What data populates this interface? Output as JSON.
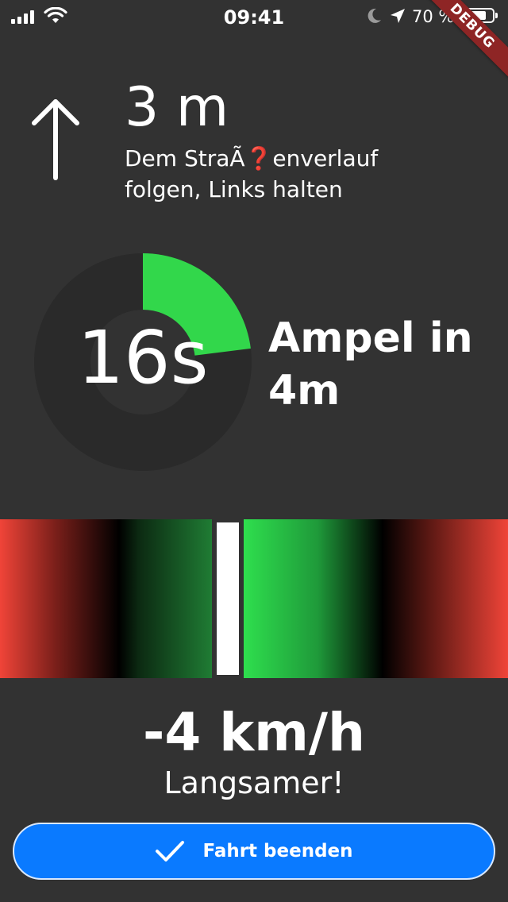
{
  "status_bar": {
    "time": "09:41",
    "battery_percent": "70 %",
    "icons": [
      "cellular-signal-icon",
      "wifi-icon",
      "moon-icon",
      "location-arrow-icon",
      "battery-icon"
    ]
  },
  "debug_banner": "DEBUG",
  "navigation": {
    "direction_icon": "arrow-up-icon",
    "distance": "3 m",
    "instruction": "Dem StraÃ❓enverlauf folgen, Links halten"
  },
  "traffic_light": {
    "countdown": "16s",
    "progress_fraction": 0.23,
    "message": "Ampel in 4m",
    "colors": {
      "progress": "#32d74b",
      "track": "#2a2a2a",
      "inner": "#323232"
    }
  },
  "speed_advice": {
    "value": "-4 km/h",
    "hint": "Langsamer!",
    "colors": {
      "too_fast_slow": "#f04438",
      "ideal": "#2fe04e",
      "marker": "#ffffff"
    }
  },
  "end_button": {
    "label": "Fahrt beenden",
    "icon": "checkmark-icon",
    "color": "#0a7aff"
  }
}
